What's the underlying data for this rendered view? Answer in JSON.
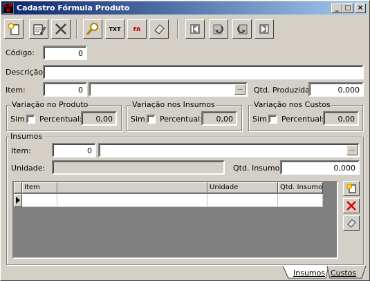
{
  "window": {
    "title": "Cadastro Fórmula Produto"
  },
  "title_buttons": {
    "minimize": "_",
    "maximize": "□",
    "close": "×"
  },
  "toolbar": {
    "new": "new-record",
    "edit": "edit-record",
    "delete": "delete-record",
    "search": "search",
    "txt_label": "TXT",
    "fa_label": "FA",
    "clear": "clear",
    "first": "first",
    "prev": "prev",
    "next": "next",
    "last": "last"
  },
  "form": {
    "codigo_label": "Código:",
    "codigo_value": "0",
    "descricao_label": "Descrição:",
    "descricao_value": "",
    "item_label": "Item:",
    "item_code": "0",
    "item_desc": "",
    "qtd_produzida_label": "Qtd. Produzida:",
    "qtd_produzida_value": "0,000",
    "ellipsis": "..."
  },
  "variacoes": [
    {
      "title": "Variação no Produto",
      "sim": "Sim",
      "percentual": "Percentual:",
      "value": "0,00"
    },
    {
      "title": "Variação nos Insumos",
      "sim": "Sim",
      "percentual": "Percentual:",
      "value": "0,00"
    },
    {
      "title": "Variação nos Custos",
      "sim": "Sim",
      "percentual": "Percentual:",
      "value": "0,00"
    }
  ],
  "insumos": {
    "title": "Insumos",
    "item_label": "Item:",
    "item_code": "0",
    "item_desc": "",
    "unidade_label": "Unidade:",
    "unidade_value": "",
    "qtd_label": "Qtd. Insumo:",
    "qtd_value": "0,000",
    "ellipsis": "...",
    "columns": [
      "Item",
      "",
      "Unidade",
      "Qtd. Insumo"
    ]
  },
  "tabs": [
    "Insumos",
    "Custos"
  ]
}
